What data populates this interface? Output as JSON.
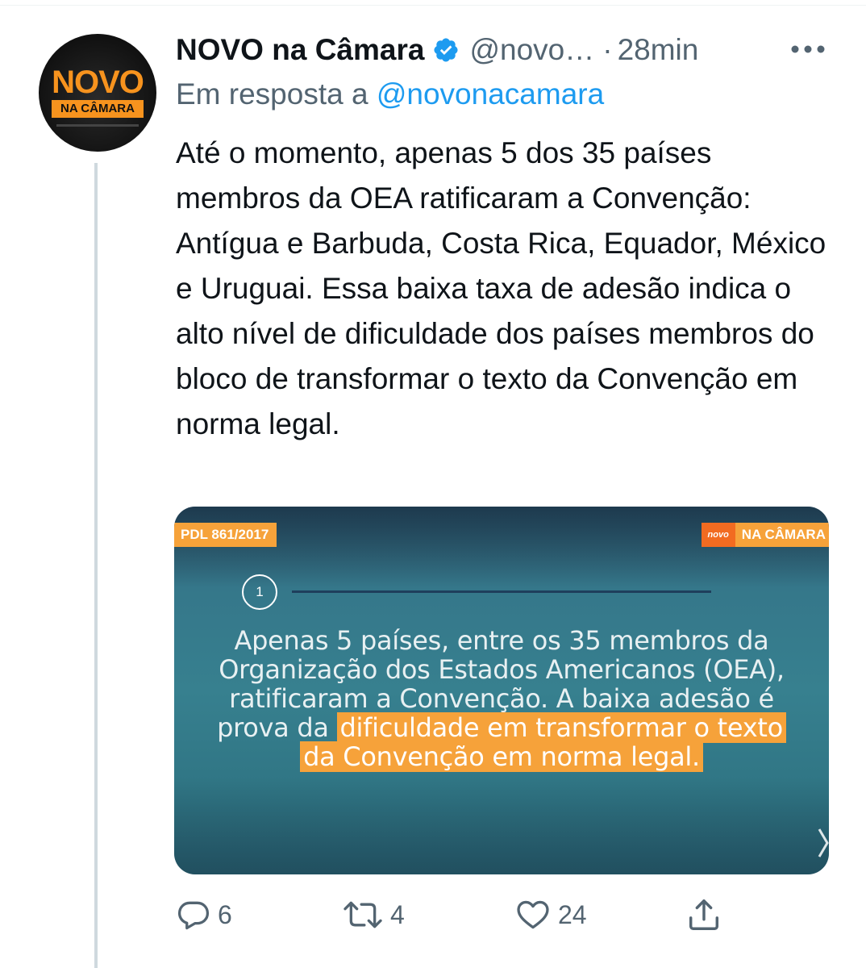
{
  "tweet": {
    "author": {
      "display_name": "NOVO na Câmara",
      "handle": "@novo…",
      "separator": "·",
      "timestamp": "28min",
      "avatar_text_top": "NOVO",
      "avatar_text_bottom": "NA CÂMARA"
    },
    "reply_context": {
      "prefix": "Em resposta a",
      "mention": "@novonacamara"
    },
    "text": "Até o momento, apenas 5 dos 35 países membros da OEA ratificaram a Convenção: Antígua e Barbuda, Costa Rica, Equador, México e Uruguai. Essa baixa taxa de adesão indica o alto nível de dificuldade dos países membros do bloco de transformar o texto da Convenção em norma legal.",
    "media": {
      "tag_left": "PDL 861/2017",
      "brand_novo": "novo",
      "brand_camara": "NA CÂMARA",
      "step_number": "1",
      "line1": "Apenas 5 países, entre os 35 membros da",
      "line2": "Organização dos Estados Americanos (OEA),",
      "line3": "ratificaram a Convenção. A baixa adesão é",
      "line4_plain": "prova da",
      "line4_highlight": "dificuldade em transformar o texto",
      "line5_highlight": "da Convenção em norma legal."
    },
    "actions": {
      "replies": "6",
      "retweets": "4",
      "likes": "24"
    }
  },
  "colors": {
    "text_primary": "#0f1419",
    "text_secondary": "#536471",
    "link": "#1d9bf0",
    "verified": "#1d9bf0",
    "brand_orange": "#f6a23a",
    "media_teal": "#37808f"
  },
  "icons": [
    "verified-icon",
    "more-icon",
    "reply-icon",
    "retweet-icon",
    "like-icon",
    "share-icon",
    "next-arrow-icon"
  ]
}
